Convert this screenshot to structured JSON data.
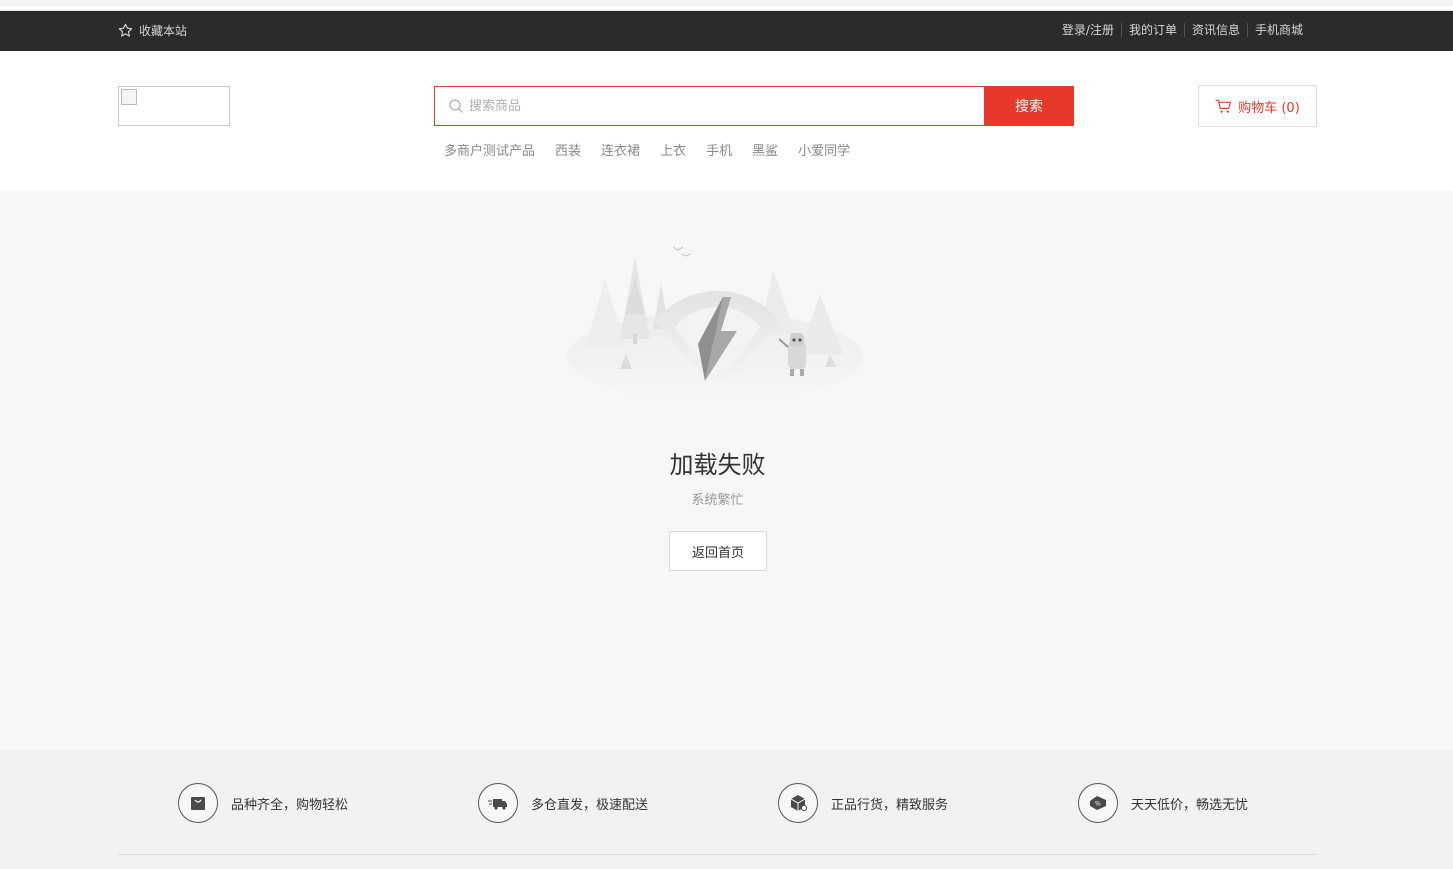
{
  "topbar": {
    "favorite_label": "收藏本站",
    "links": [
      "登录/注册",
      "我的订单",
      "资讯信息",
      "手机商城"
    ]
  },
  "header": {
    "search_placeholder": "搜索商品",
    "search_button": "搜索",
    "hot_words": [
      "多商户测试产品",
      "西装",
      "连衣裙",
      "上衣",
      "手机",
      "黑鲨",
      "小爱同学"
    ],
    "cart_label": "购物车 (0)"
  },
  "error": {
    "title": "加载失败",
    "subtitle": "系统繁忙",
    "home_button": "返回首页"
  },
  "footer": {
    "services": [
      {
        "label": "品种齐全，购物轻松",
        "icon": "shopping-bag-icon"
      },
      {
        "label": "多仓直发，极速配送",
        "icon": "delivery-truck-icon"
      },
      {
        "label": "正品行货，精致服务",
        "icon": "package-icon"
      },
      {
        "label": "天天低价，畅选无忧",
        "icon": "discount-tag-icon"
      }
    ]
  },
  "colors": {
    "accent": "#e8382a",
    "topbar_bg": "#2b2b2b",
    "main_bg": "#f7f7f7",
    "footer_bg": "#f2f2f2"
  }
}
